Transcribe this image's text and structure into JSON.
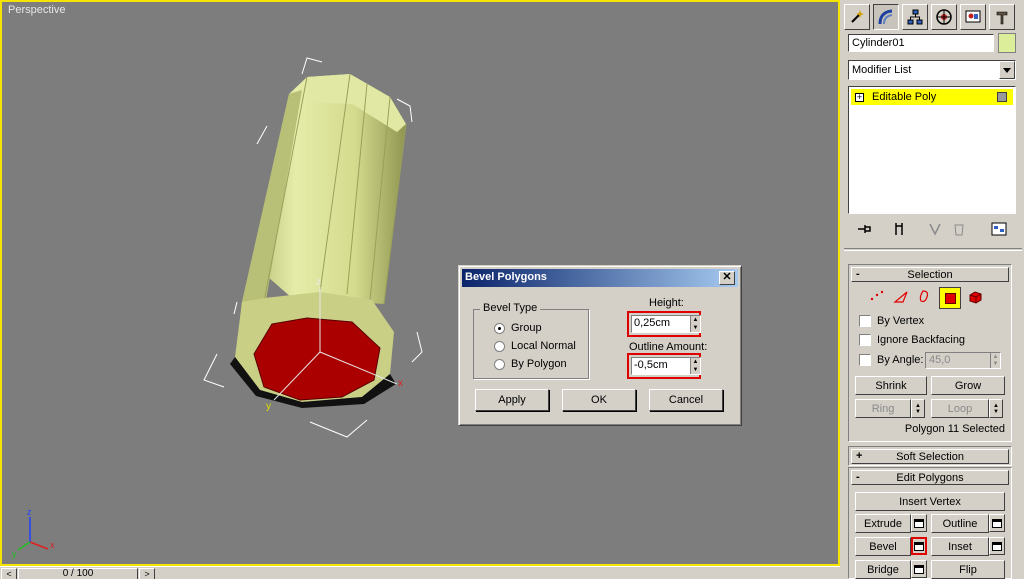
{
  "viewport": {
    "label": "Perspective"
  },
  "timeline": {
    "frame": "0 / 100",
    "left_arrow": "<",
    "right_arrow": ">"
  },
  "command_panel": {
    "object_name": "Cylinder01",
    "object_color": "#dcee9a",
    "modifier_list": "Modifier List",
    "stack_item": "Editable Poly",
    "selection": {
      "title": "Selection",
      "by_vertex": "By Vertex",
      "ignore_backfacing": "Ignore Backfacing",
      "by_angle": "By Angle:",
      "angle_value": "45,0",
      "shrink": "Shrink",
      "grow": "Grow",
      "ring": "Ring",
      "loop": "Loop",
      "status": "Polygon 11 Selected"
    },
    "soft_selection": {
      "title": "Soft Selection",
      "sign": "+"
    },
    "edit_polygons": {
      "title": "Edit Polygons",
      "sign": "-",
      "insert_vertex": "Insert Vertex",
      "extrude": "Extrude",
      "outline": "Outline",
      "bevel": "Bevel",
      "inset": "Inset",
      "bridge": "Bridge",
      "flip": "Flip"
    }
  },
  "dialog": {
    "title": "Bevel Polygons",
    "bevel_type_label": "Bevel Type",
    "options": [
      "Group",
      "Local Normal",
      "By Polygon"
    ],
    "selected_option": "Group",
    "height_label": "Height:",
    "height_value": "0,25cm",
    "outline_label": "Outline Amount:",
    "outline_value": "-0,5cm",
    "apply": "Apply",
    "ok": "OK",
    "cancel": "Cancel"
  },
  "gizmo": {
    "x_label": "x",
    "y_label": "y",
    "z_label": "z"
  },
  "colors": {
    "viewport_bg": "#7d7d7d",
    "active_border": "#f6e400",
    "face_selected": "#aa0000",
    "mesh": "#d8e09a",
    "stack_highlight": "#ffff00",
    "highlight_box": "#e00000"
  }
}
